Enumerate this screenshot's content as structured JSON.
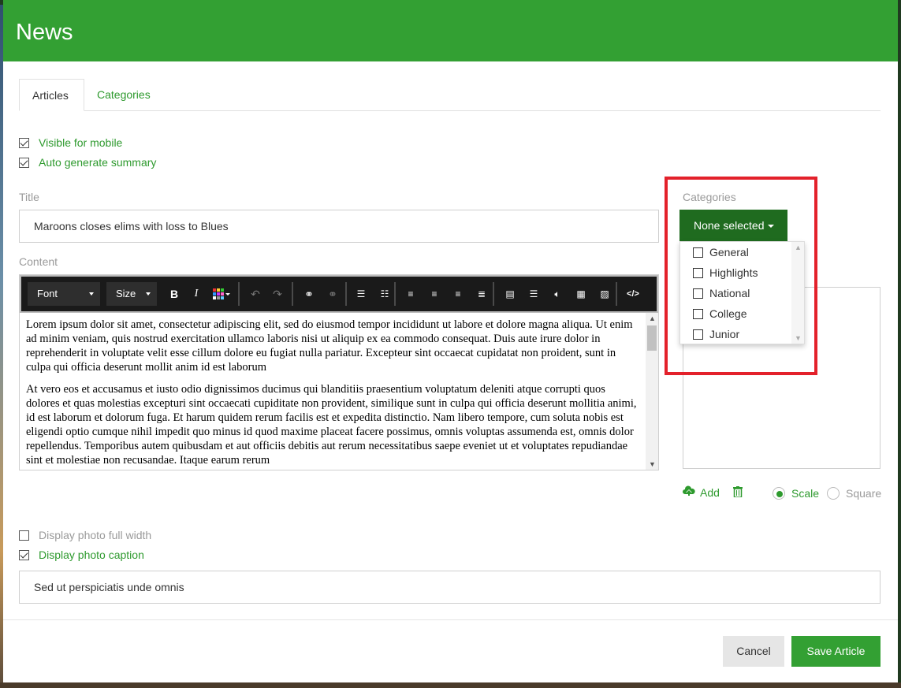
{
  "modal": {
    "title": "News"
  },
  "tabs": [
    {
      "label": "Articles"
    },
    {
      "label": "Categories"
    }
  ],
  "options": {
    "visible_mobile": {
      "label": "Visible for mobile",
      "checked": true
    },
    "auto_summary": {
      "label": "Auto generate summary",
      "checked": true
    }
  },
  "title_field": {
    "label": "Title",
    "value": "Maroons closes elims with loss to Blues"
  },
  "content_field": {
    "label": "Content",
    "toolbar": {
      "font_label": "Font",
      "size_label": "Size"
    },
    "paragraphs": [
      "Lorem ipsum dolor sit amet, consectetur adipiscing elit, sed do eiusmod tempor incididunt ut labore et dolore magna aliqua. Ut enim ad minim veniam, quis nostrud exercitation ullamco laboris nisi ut aliquip ex ea commodo consequat. Duis aute irure dolor in reprehenderit in voluptate velit esse cillum dolore eu fugiat nulla pariatur. Excepteur sint occaecat cupidatat non proident, sunt in culpa qui officia deserunt mollit anim id est laborum",
      "At vero eos et accusamus et iusto odio dignissimos ducimus qui blanditiis praesentium voluptatum deleniti atque corrupti quos dolores et quas molestias excepturi sint occaecati cupiditate non provident, similique sunt in culpa qui officia deserunt mollitia animi, id est laborum et dolorum fuga. Et harum quidem rerum facilis est et expedita distinctio. Nam libero tempore, cum soluta nobis est eligendi optio cumque nihil impedit quo minus id quod maxime placeat facere possimus, omnis voluptas assumenda est, omnis dolor repellendus. Temporibus autem quibusdam et aut officiis debitis aut rerum necessitatibus saepe eveniet ut et voluptates repudiandae sint et molestiae non recusandae. Itaque earum rerum"
    ]
  },
  "categories": {
    "label": "Categories",
    "button_label": "None selected",
    "items": [
      {
        "label": "General",
        "checked": false
      },
      {
        "label": "Highlights",
        "checked": false
      },
      {
        "label": "National",
        "checked": false
      },
      {
        "label": "College",
        "checked": false
      },
      {
        "label": "Junior",
        "checked": false
      }
    ]
  },
  "image": {
    "add_label": "Add",
    "scale_label": "Scale",
    "square_label": "Square",
    "selected_mode": "Scale"
  },
  "photo_options": {
    "full_width": {
      "label": "Display photo full width",
      "checked": false
    },
    "caption": {
      "label": "Display photo caption",
      "checked": true
    }
  },
  "caption_field": {
    "value": "Sed ut perspiciatis unde omnis"
  },
  "footer": {
    "cancel_label": "Cancel",
    "save_label": "Save Article"
  },
  "colors": {
    "brand_green": "#33a033",
    "dark_green": "#1f6b1f",
    "highlight_red": "#e3212b"
  }
}
